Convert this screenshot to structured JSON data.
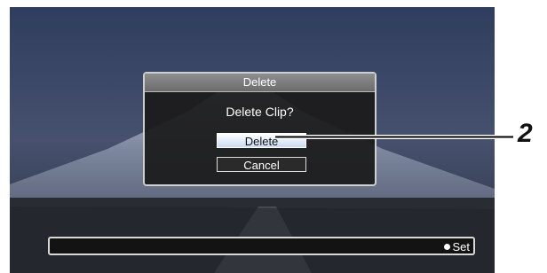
{
  "dialog": {
    "title": "Delete",
    "message": "Delete Clip?",
    "delete_label": "Delete",
    "cancel_label": "Cancel"
  },
  "bottom_bar": {
    "set_label": "Set",
    "set_icon": "filled-circle"
  },
  "callout": {
    "number": "2"
  },
  "colors": {
    "dialog_title_bg": "#7d7d7d",
    "selected_button_bg": "#dfe8f6",
    "panel_bg": "#1c1c1c"
  }
}
